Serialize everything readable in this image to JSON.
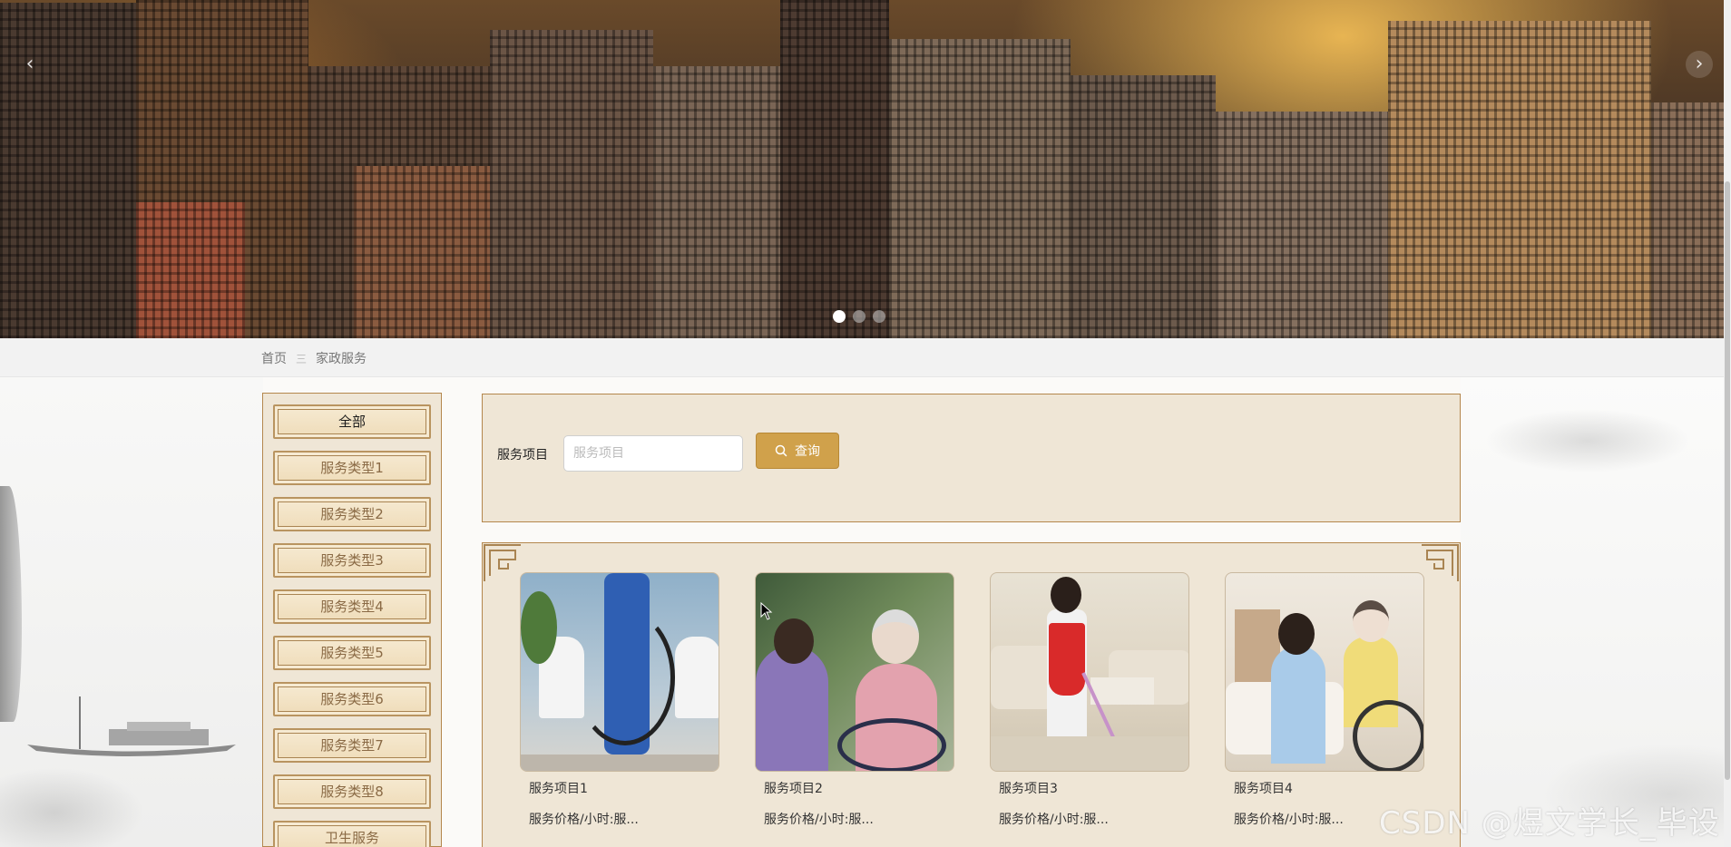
{
  "carousel": {
    "prev_icon": "chevron-left-icon",
    "next_icon": "chevron-right-icon",
    "slide_count": 3,
    "active_slide": 1
  },
  "breadcrumb": {
    "home": "首页",
    "separator": "三",
    "current": "家政服务"
  },
  "sidebar": {
    "items": [
      {
        "label": "全部",
        "active": true
      },
      {
        "label": "服务类型1"
      },
      {
        "label": "服务类型2"
      },
      {
        "label": "服务类型3"
      },
      {
        "label": "服务类型4"
      },
      {
        "label": "服务类型5"
      },
      {
        "label": "服务类型6"
      },
      {
        "label": "服务类型7"
      },
      {
        "label": "服务类型8"
      },
      {
        "label": "卫生服务"
      }
    ]
  },
  "search": {
    "label": "服务项目",
    "placeholder": "服务项目",
    "value": "",
    "button_label": "查询"
  },
  "products": [
    {
      "title": "服务项目1",
      "price": "服务价格/小时:服..."
    },
    {
      "title": "服务项目2",
      "price": "服务价格/小时:服..."
    },
    {
      "title": "服务项目3",
      "price": "服务价格/小时:服..."
    },
    {
      "title": "服务项目4",
      "price": "服务价格/小时:服..."
    }
  ],
  "watermark": "CSDN @煜文学长_毕设",
  "colors": {
    "accent": "#d0a14b",
    "panel_bg": "#efe6d6",
    "panel_border": "#b4874d"
  }
}
